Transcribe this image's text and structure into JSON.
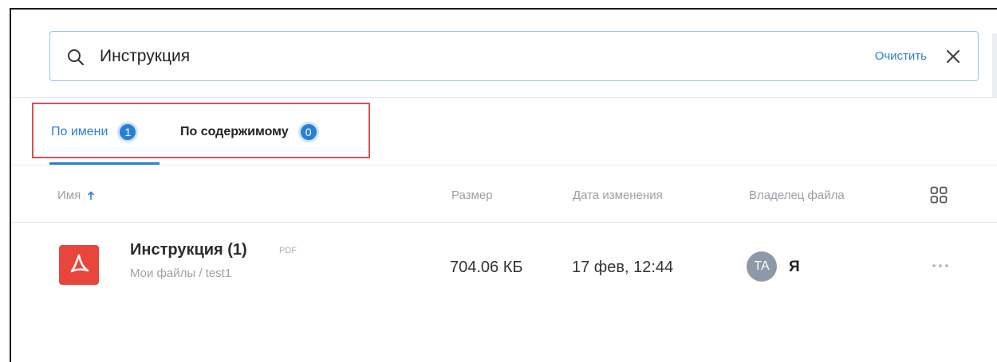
{
  "search": {
    "query": "Инструкция",
    "clear_label": "Очистить"
  },
  "tabs": [
    {
      "label": "По имени",
      "count": "1",
      "active": true
    },
    {
      "label": "По содержимому",
      "count": "0",
      "active": false
    }
  ],
  "table": {
    "columns": {
      "name": "Имя",
      "size": "Размер",
      "date": "Дата изменения",
      "owner": "Владелец файла"
    },
    "sort": "ascending",
    "rows": [
      {
        "name": "Инструкция (1)",
        "ext": "PDF",
        "path": "Мои файлы / test1",
        "size": "704.06 КБ",
        "modified": "17 фев, 12:44",
        "owner_initials": "TA",
        "owner_name": "Я"
      }
    ]
  },
  "icons": {
    "search": "search-icon",
    "close": "close-icon",
    "sort": "arrow-up-icon",
    "grid": "grid-view-icon",
    "file": "pdf-file-icon",
    "more": "more-horizontal-icon"
  },
  "colors": {
    "accent": "#2a7fd4",
    "highlight_box": "#d9534f",
    "pdf": "#e8453c",
    "avatar": "#8d99a8"
  }
}
